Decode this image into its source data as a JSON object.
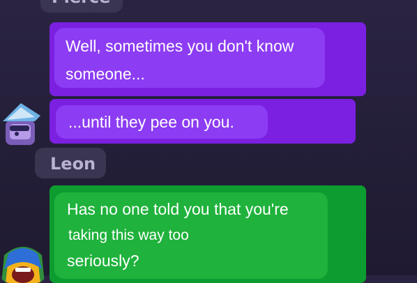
{
  "chat": {
    "pierce_name": "Pierce",
    "leon_name": "Leon",
    "messages": [
      {
        "lines": [
          "Well, sometimes you don't know",
          "someone..."
        ]
      },
      {
        "lines": [
          "...until they pee on you."
        ]
      },
      {
        "lines": [
          "Has no one told you that you're",
          "taking this way too",
          "seriously?"
        ]
      }
    ]
  },
  "colors": {
    "purple_bubble": "#8c3cf3",
    "green_bubble": "#1fb23c",
    "background": "#231e37"
  },
  "icons": {
    "pierce_avatar": "pirate-hat-brawler-icon",
    "leon_avatar": "lizard-hood-brawler-icon"
  }
}
